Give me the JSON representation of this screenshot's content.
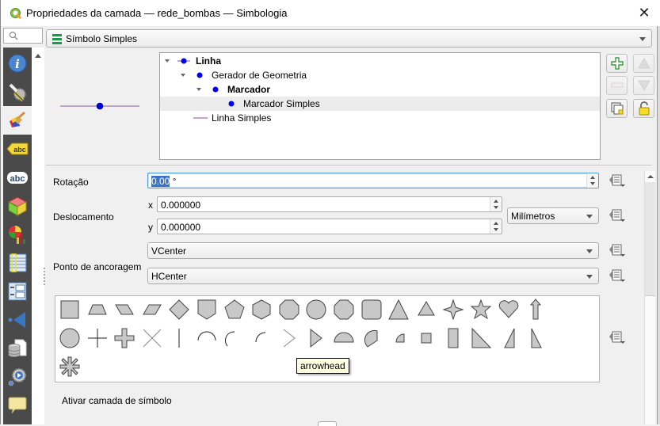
{
  "window": {
    "title": "Propriedades da camada — rede_bombas — Simbologia",
    "close_glyph": "✕"
  },
  "search": {
    "placeholder": ""
  },
  "sidebar": {
    "items": [
      {
        "name": "information",
        "icon": "info-icon",
        "active": false
      },
      {
        "name": "source",
        "icon": "wrench-gear-icon",
        "active": false
      },
      {
        "name": "symbology",
        "icon": "paintbrush-icon",
        "active": true
      },
      {
        "name": "labels",
        "icon": "label-abc-icon",
        "active": false
      },
      {
        "name": "masks",
        "icon": "mask-abc-icon",
        "active": false
      },
      {
        "name": "3d-view",
        "icon": "cube-icon",
        "active": false
      },
      {
        "name": "diagrams",
        "icon": "diagram-icon",
        "active": false
      },
      {
        "name": "fields",
        "icon": "fields-icon",
        "active": false
      },
      {
        "name": "attributes-form",
        "icon": "form-icon",
        "active": false
      },
      {
        "name": "joins",
        "icon": "join-icon",
        "active": false
      },
      {
        "name": "auxiliary-storage",
        "icon": "storage-icon",
        "active": false
      },
      {
        "name": "actions",
        "icon": "actions-gear-icon",
        "active": false
      },
      {
        "name": "display",
        "icon": "speech-bubble-icon",
        "active": false
      }
    ]
  },
  "renderer": {
    "selected": "Símbolo Simples",
    "icon": "single-symbol-icon"
  },
  "colors": {
    "marker_fill": "#0000ee",
    "line_color": "#8b5ca3",
    "line_light": "#c3a4cf",
    "selection": "#3b73c9",
    "lock_yellow": "#f5dc2a",
    "plus_green": "#3e9a3e"
  },
  "layer_tree": {
    "rows": [
      {
        "label": "Linha",
        "bold": true,
        "level": 0,
        "expanded": true,
        "symbol": "line-marker"
      },
      {
        "label": "Gerador de Geometria",
        "bold": false,
        "level": 1,
        "expanded": true,
        "symbol": "dot"
      },
      {
        "label": "Marcador",
        "bold": true,
        "level": 2,
        "expanded": true,
        "symbol": "dot"
      },
      {
        "label": "Marcador Simples",
        "bold": false,
        "level": 3,
        "expanded": null,
        "symbol": "dot",
        "selected": true
      },
      {
        "label": "Linha Simples",
        "bold": false,
        "level": 1,
        "expanded": null,
        "symbol": "line"
      }
    ]
  },
  "tool_buttons": {
    "add": "add-layer-icon",
    "remove": "remove-layer-icon",
    "up": "move-up-icon",
    "down": "move-down-icon",
    "duplicate": "duplicate-icon",
    "lock": "lock-icon"
  },
  "form": {
    "rotation": {
      "label": "Rotação",
      "value_selected": "0.00",
      "suffix": " °"
    },
    "offset": {
      "label": "Deslocamento",
      "x_label": "x",
      "x_value": "0.000000",
      "y_label": "y",
      "y_value": "0.000000",
      "unit": "Milímetros"
    },
    "anchor": {
      "label": "Ponto de ancoragem",
      "vertical": "VCenter",
      "horizontal": "HCenter"
    }
  },
  "shapes": {
    "items": [
      "square",
      "trapezoid",
      "parallelogram-right",
      "parallelogram-left",
      "diamond",
      "shield",
      "pentagon",
      "hexagon",
      "octagon",
      "decagon",
      "rounded-octagon",
      "rounded-square",
      "triangle",
      "equilateral-triangle",
      "four-point-star",
      "star",
      "heart",
      "arrow",
      "circle",
      "cross",
      "cross-fill",
      "cross2",
      "line",
      "semi-arc",
      "third-arc",
      "quarter-arc",
      "arrowhead",
      "filled-arrowhead",
      "half-circle",
      "third-circle",
      "quarter-circle",
      "quarter-square",
      "half-square",
      "right-half-triangle",
      "left-half-triangle",
      "diagonal-half-square",
      "asterisk-fill"
    ],
    "tooltip": "arrowhead"
  },
  "enable_layer_label": "Ativar camada de símbolo"
}
